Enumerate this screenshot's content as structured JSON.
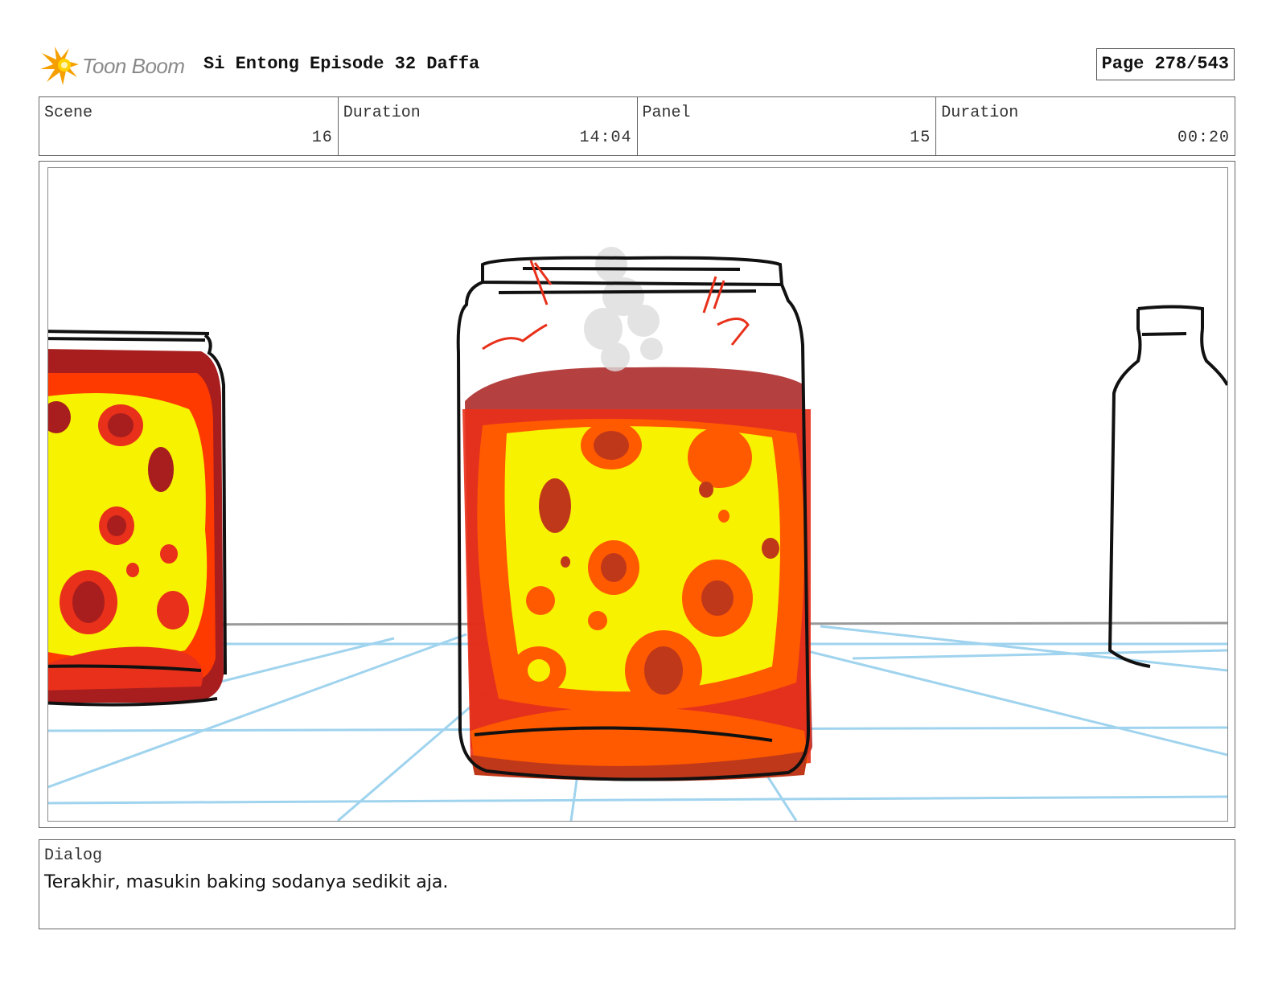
{
  "header": {
    "logo_text": "Toon Boom",
    "project_title": "Si Entong Episode 32 Daffa",
    "page_label": "Page 278/543"
  },
  "info": {
    "scene_label": "Scene",
    "scene_value": "16",
    "scene_duration_label": "Duration",
    "scene_duration_value": "14:04",
    "panel_label": "Panel",
    "panel_value": "15",
    "panel_duration_label": "Duration",
    "panel_duration_value": "00:20"
  },
  "dialog": {
    "label": "Dialog",
    "text": "Terakhir, masukin baking sodanya sedikit aja."
  },
  "colors": {
    "ink": "#111111",
    "grid_blue": "#9fd3ee",
    "jar_yellow": "#f7f200",
    "jar_orange": "#ff5a00",
    "jar_red": "#e8301a",
    "jar_dark_red": "#a81e1e",
    "logo_orange": "#f5a000"
  },
  "icons": {
    "logo": "toon-boom-starburst-icon"
  }
}
